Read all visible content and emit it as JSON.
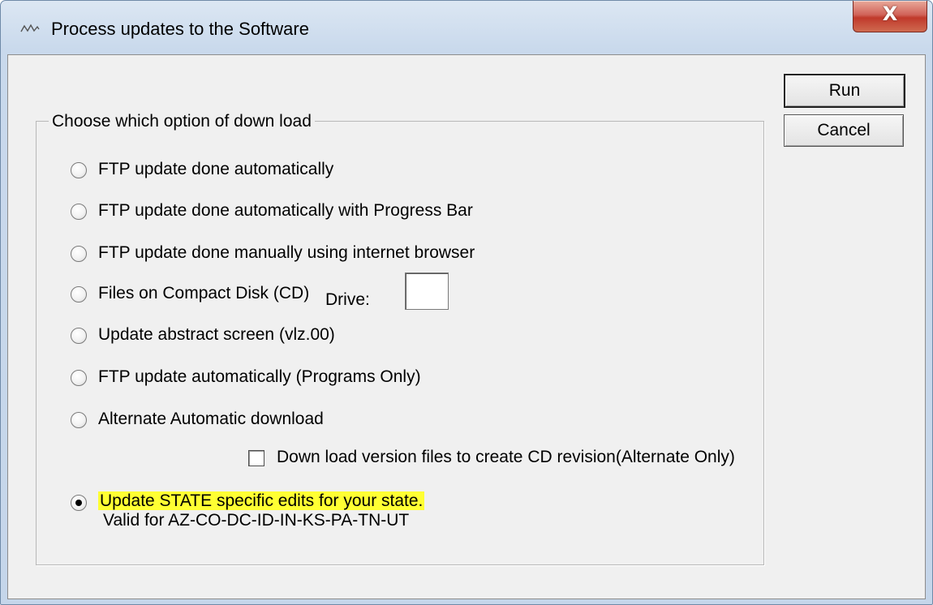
{
  "window": {
    "title": "Process updates to the Software",
    "close_glyph": "X"
  },
  "buttons": {
    "run_label": "Run",
    "cancel_label": "Cancel"
  },
  "group": {
    "legend": "Choose which option of down load",
    "options": [
      {
        "label": "FTP update done automatically",
        "checked": false
      },
      {
        "label": "FTP update done automatically with Progress Bar",
        "checked": false
      },
      {
        "label": "FTP update done manually using internet browser",
        "checked": false
      },
      {
        "label": "Files on Compact Disk (CD)",
        "checked": false
      },
      {
        "label": "Update abstract screen  (vlz.00)",
        "checked": false
      },
      {
        "label": "FTP update automatically  (Programs Only)",
        "checked": false
      },
      {
        "label": "Alternate Automatic download",
        "checked": false
      },
      {
        "label": "Update STATE specific edits for your state.",
        "checked": true
      }
    ],
    "drive_label": "Drive:",
    "drive_value": "",
    "alternate_checkbox": {
      "label": "Down load version files to create CD revision(Alternate Only)",
      "checked": false
    },
    "state_note": "Valid for AZ-CO-DC-ID-IN-KS-PA-TN-UT",
    "highlight_color": "#ffff33"
  }
}
